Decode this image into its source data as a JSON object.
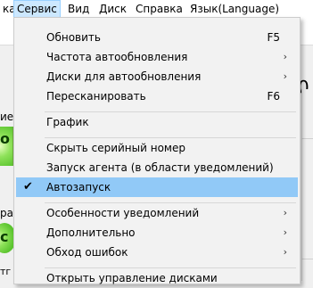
{
  "menubar": {
    "items": [
      {
        "label": "ка",
        "active": false
      },
      {
        "label": "Сервис",
        "active": true
      },
      {
        "label": "Вид",
        "active": false
      },
      {
        "label": "Диск",
        "active": false
      },
      {
        "label": "Справка",
        "active": false
      },
      {
        "label": "Язык(Language)",
        "active": false
      }
    ]
  },
  "background": {
    "label_left_1": "ие",
    "label_left_2": "ра",
    "label_bottom": "тг",
    "green_text_1": "о",
    "green_text_2": "с",
    "zero_value": "0"
  },
  "menu": {
    "items": {
      "refresh": {
        "label": "Обновить",
        "shortcut": "F5"
      },
      "autorefresh_freq": {
        "label": "Частота автообновления",
        "submenu": "›"
      },
      "autorefresh_disks": {
        "label": "Диски для автообновления",
        "submenu": "›"
      },
      "rescan": {
        "label": "Пересканировать",
        "shortcut": "F6"
      },
      "graph": {
        "label": "График"
      },
      "hide_serial": {
        "label": "Скрыть серийный номер"
      },
      "launch_agent": {
        "label": "Запуск агента (в области уведомлений)"
      },
      "autostart": {
        "label": "Автозапуск",
        "checked": true,
        "check_glyph": "✔"
      },
      "notifications": {
        "label": "Особенности уведомлений",
        "submenu": "›"
      },
      "advanced": {
        "label": "Дополнительно",
        "submenu": "›"
      },
      "workarounds": {
        "label": "Обход ошибок",
        "submenu": "›"
      },
      "disk_management": {
        "label": "Открыть управление дисками"
      }
    }
  },
  "colors": {
    "highlight": "#91c9f7",
    "menubar_active": "#cce8ff",
    "menu_bg": "#f2f2f2"
  }
}
